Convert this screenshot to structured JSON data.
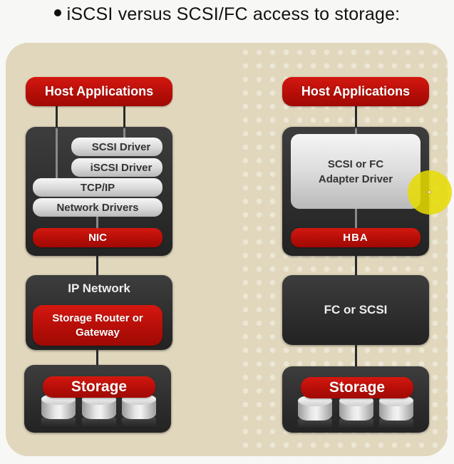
{
  "title": "iSCSI versus SCSI/FC access to storage:",
  "colors": {
    "panel": "#e0d7bd",
    "red": "#c0100a",
    "dark": "#303030",
    "grey_pill": "#d9d9d9",
    "cursor_highlight": "#e6dc00"
  },
  "left_stack": {
    "host_applications": "Host Applications",
    "scsi_driver": "SCSI Driver",
    "iscsi_driver": "iSCSI Driver",
    "tcp_ip": "TCP/IP",
    "network_drivers": "Network Drivers",
    "nic": "NIC",
    "ip_network": "IP Network",
    "storage_router": "Storage Router or Gateway",
    "storage": "Storage"
  },
  "right_stack": {
    "host_applications": "Host Applications",
    "adapter_driver_line1": "SCSI or FC",
    "adapter_driver_line2": "Adapter Driver",
    "hba": "HBA",
    "fc_or_scsi": "FC or SCSI",
    "storage": "Storage"
  }
}
